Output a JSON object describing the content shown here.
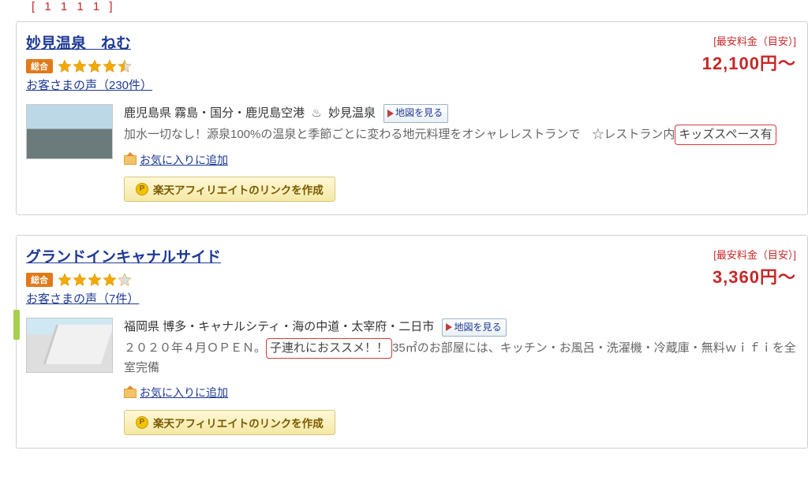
{
  "header_scrap": "[ 1 1 1 1 ]",
  "listings": [
    {
      "title": "妙見温泉　ねむ",
      "rating_badge": "総合",
      "rating_value": 4.5,
      "reviews_text": "お客さまの声（230件）",
      "price_label": "[最安料金（目安）]",
      "price": "12,100円～",
      "location": "鹿児島県 霧島・国分・鹿児島空港",
      "onsen_name": "妙見温泉",
      "map_btn": "地図を見る",
      "desc_pre": "加水一切なし！源泉100%の温泉と季節ごとに変わる地元料理をオシャレレストランで　☆レストラン内",
      "desc_hl": "キッズスペース有",
      "desc_post": "",
      "fav": "お気に入りに追加",
      "aff": "楽天アフィリエイトのリンクを作成"
    },
    {
      "title": "グランドインキャナルサイド",
      "rating_badge": "総合",
      "rating_value": 4.0,
      "reviews_text": "お客さまの声（7件）",
      "price_label": "[最安料金（目安）]",
      "price": "3,360円～",
      "location": "福岡県 博多・キャナルシティ・海の中道・太宰府・二日市",
      "map_btn": "地図を見る",
      "desc_pre": "２０２０年４月ＯＰＥＮ。",
      "desc_hl": "子連れにおススメ！！",
      "desc_post": "35㎡のお部屋には、キッチン・お風呂・洗濯機・冷蔵庫・無料ｗｉｆｉを全室完備",
      "fav": "お気に入りに追加",
      "aff": "楽天アフィリエイトのリンクを作成"
    }
  ]
}
